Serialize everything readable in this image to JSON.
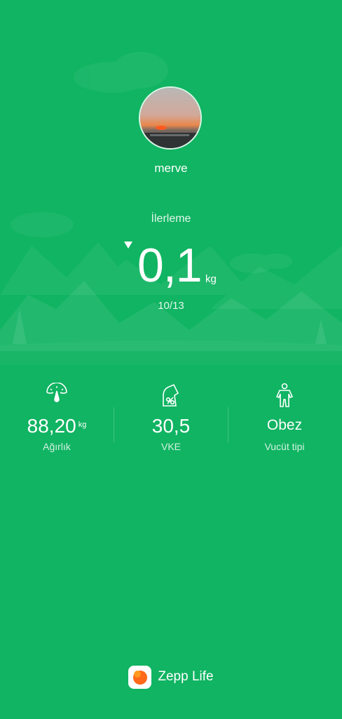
{
  "profile": {
    "name": "merve"
  },
  "progress": {
    "label": "İlerleme",
    "value": "0,1",
    "unit": "kg",
    "date": "10/13",
    "trend_icon": "triangle-down-icon"
  },
  "stats": [
    {
      "icon": "scale-icon",
      "value": "88,20",
      "unit": "kg",
      "label": "Ağırlık"
    },
    {
      "icon": "bmi-icon",
      "value": "30,5",
      "unit": "",
      "label": "VKE"
    },
    {
      "icon": "body-icon",
      "value": "Obez",
      "unit": "",
      "label": "Vucüt tipi"
    }
  ],
  "footer": {
    "app_name": "Zepp Life",
    "app_icon": "zepp-life-logo-icon"
  },
  "colors": {
    "background": "#10b462",
    "text": "#ffffff",
    "logo_accent": "#ff6a1a"
  }
}
